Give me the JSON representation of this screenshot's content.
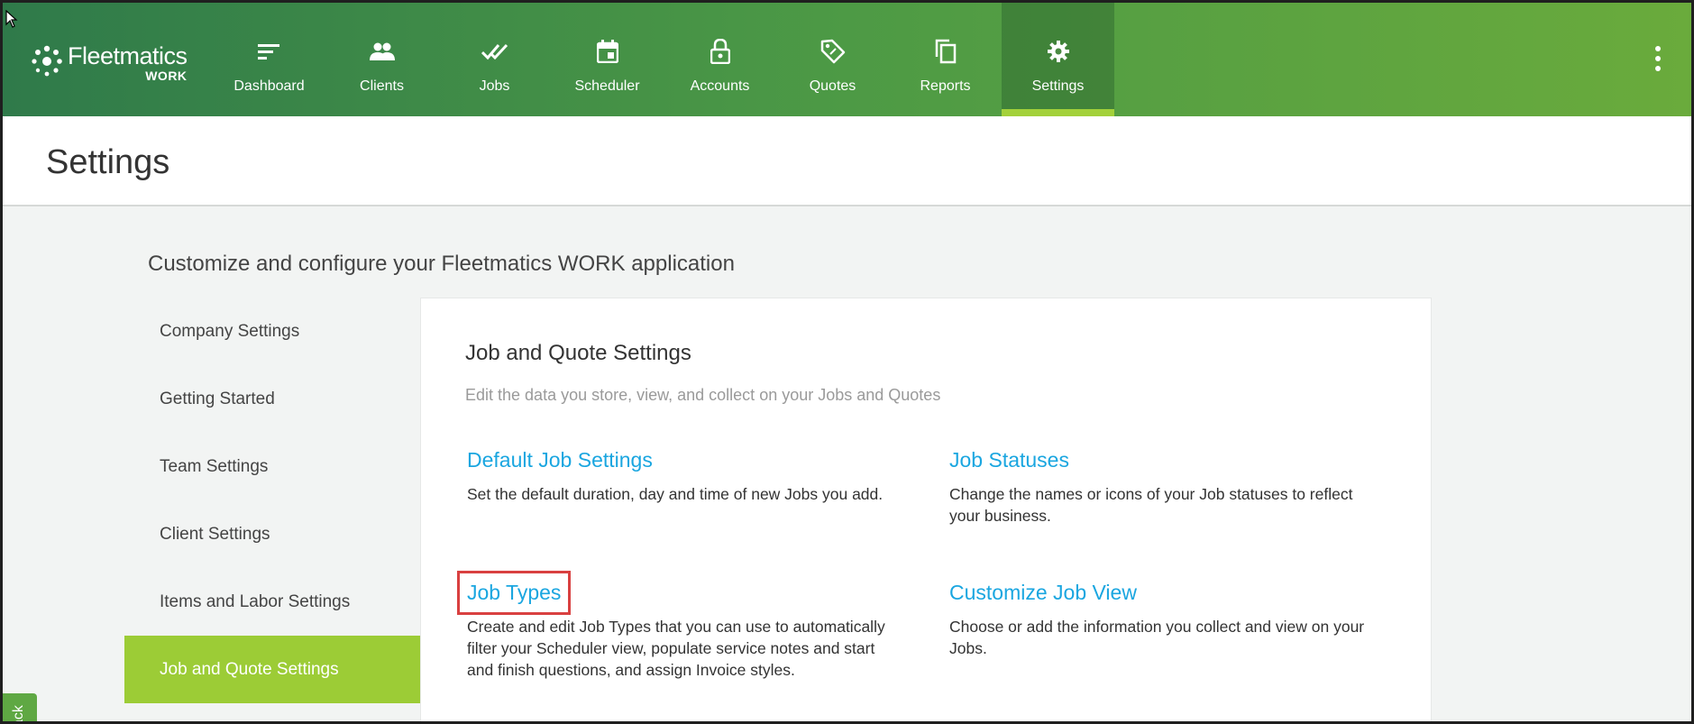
{
  "brand": {
    "name": "Fleetmatics",
    "sub": "WORK"
  },
  "nav": [
    {
      "label": "Dashboard",
      "icon": "dashboard-icon"
    },
    {
      "label": "Clients",
      "icon": "clients-icon"
    },
    {
      "label": "Jobs",
      "icon": "jobs-icon"
    },
    {
      "label": "Scheduler",
      "icon": "scheduler-icon"
    },
    {
      "label": "Accounts",
      "icon": "lock-icon"
    },
    {
      "label": "Quotes",
      "icon": "tag-icon"
    },
    {
      "label": "Reports",
      "icon": "copy-icon"
    },
    {
      "label": "Settings",
      "icon": "gear-icon",
      "active": true
    }
  ],
  "page": {
    "title": "Settings",
    "intro": "Customize and configure your Fleetmatics WORK application"
  },
  "sidebar": [
    {
      "label": "Company Settings"
    },
    {
      "label": "Getting Started"
    },
    {
      "label": "Team Settings"
    },
    {
      "label": "Client Settings"
    },
    {
      "label": "Items and Labor Settings"
    },
    {
      "label": "Job and Quote Settings",
      "active": true
    }
  ],
  "panel": {
    "title": "Job and Quote Settings",
    "subtitle": "Edit the data you store, view, and collect on your Jobs and Quotes",
    "cards": [
      {
        "title": "Default Job Settings",
        "desc": "Set the default duration, day and time of new Jobs you add."
      },
      {
        "title": "Job Statuses",
        "desc": "Change the names or icons of your Job statuses to reflect your business."
      },
      {
        "title": "Job Types",
        "desc": "Create and edit Job Types that you can use to automatically filter your Scheduler view, populate service notes and start and finish questions, and assign Invoice styles.",
        "highlighted": true
      },
      {
        "title": "Customize Job View",
        "desc": "Choose or add the information you collect and view on your Jobs."
      }
    ]
  },
  "feedback_label": "ack",
  "colors": {
    "accent_green": "#9ccc36",
    "link_blue": "#1aa6e0",
    "highlight_red": "#d94040"
  }
}
